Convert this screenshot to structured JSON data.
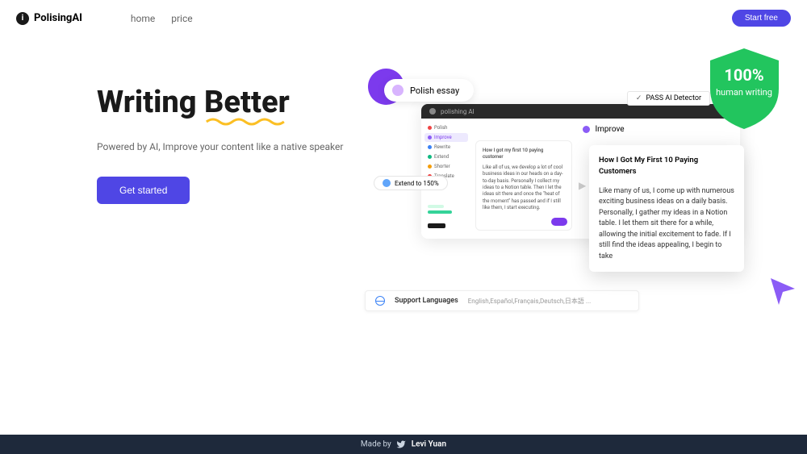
{
  "brand": "PolisingAI",
  "nav": {
    "home": "home",
    "price": "price"
  },
  "header": {
    "start_free": "Start free"
  },
  "hero": {
    "headline_1": "Writing",
    "headline_2": "Better",
    "subtitle": "Powered by AI, Improve your content like a native speaker",
    "cta": "Get started"
  },
  "pills": {
    "polish": "Polish essay",
    "pass": "PASS AI Detector",
    "extend": "Extend to 150%"
  },
  "shield": {
    "percent": "100%",
    "text": "human writing"
  },
  "app": {
    "title": "polishing AI",
    "sidebar": {
      "items": [
        "Polish",
        "Improve",
        "Rewrite",
        "Extend",
        "Shorter",
        "Translate"
      ]
    },
    "improve": "Improve",
    "card_left": {
      "title": "How I got my first 10 paying customer",
      "body": "Like all of us, we develop a lot of cool business ideas in our heads on a day-to-day basis. Personally I collect my ideas to a Notion table. Then I let the ideas sit there and once the \"heat of the moment\" has passed and if I still like them, I start executing."
    }
  },
  "big_card": {
    "title": "How I Got My First 10 Paying Customers",
    "body": "Like many of us, I come up with numerous exciting business ideas on a daily basis. Personally, I gather my ideas in a Notion table. I let them sit there for a while, allowing the initial excitement to fade. If I still find the ideas appealing, I begin to take"
  },
  "languages": {
    "label": "Support  Languages",
    "list": "English,Español,Français,Deutsch,日本語 ..."
  },
  "footer": {
    "made_by": "Made by",
    "author": "Levi Yuan"
  }
}
